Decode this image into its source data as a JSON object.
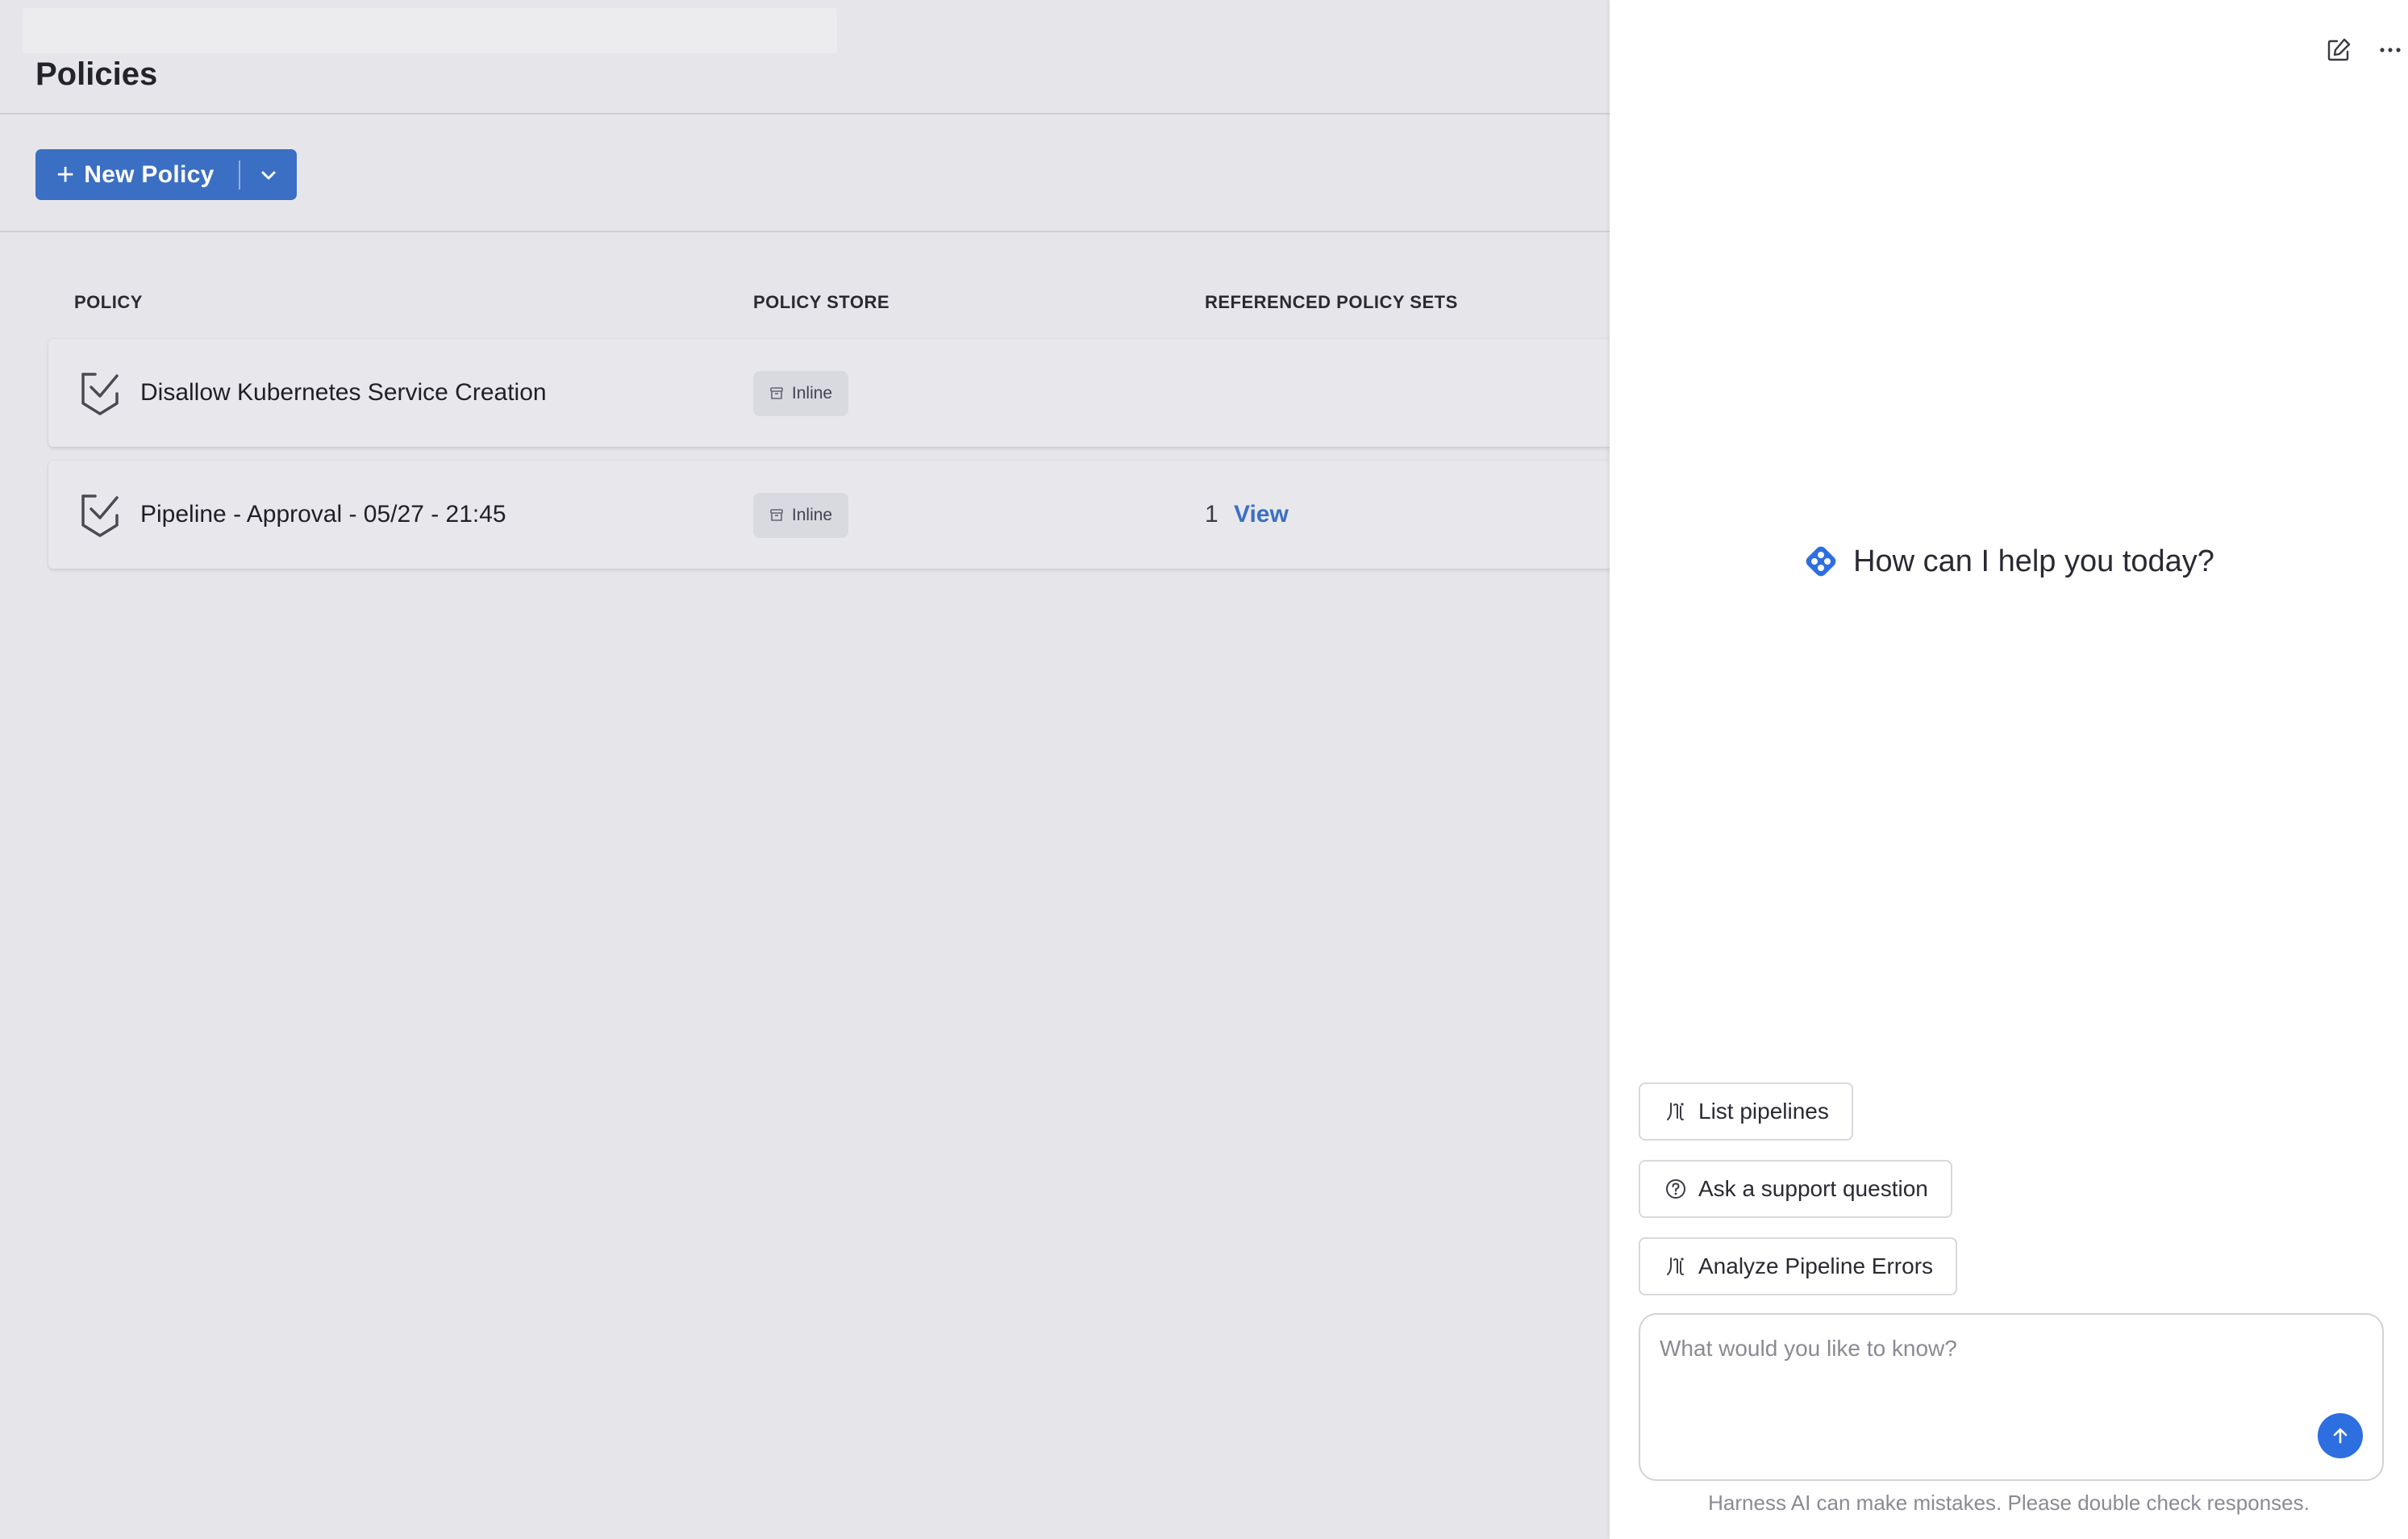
{
  "page": {
    "title": "Policies",
    "new_policy_label": "New Policy"
  },
  "table": {
    "headers": [
      "POLICY",
      "POLICY STORE",
      "REFERENCED POLICY SETS"
    ],
    "rows": [
      {
        "name": "Disallow Kubernetes Service Creation",
        "store": "Inline",
        "ref_count": "",
        "ref_link": ""
      },
      {
        "name": "Pipeline - Approval - 05/27 - 21:45",
        "store": "Inline",
        "ref_count": "1",
        "ref_link": "View"
      }
    ]
  },
  "assistant": {
    "greeting": "How can I help you today?",
    "suggestions": [
      {
        "label": "List pipelines",
        "icon": "pipeline-icon"
      },
      {
        "label": "Ask a support question",
        "icon": "help-circle-icon"
      },
      {
        "label": "Analyze Pipeline Errors",
        "icon": "pipeline-icon"
      }
    ],
    "input_placeholder": "What would you like to know?",
    "input_value": "",
    "disclaimer": "Harness AI can make mistakes. Please double check responses."
  },
  "colors": {
    "primary": "#3b6fc3",
    "send": "#2d6fe0",
    "background": "#e6e6ea",
    "panel": "#ffffff"
  }
}
